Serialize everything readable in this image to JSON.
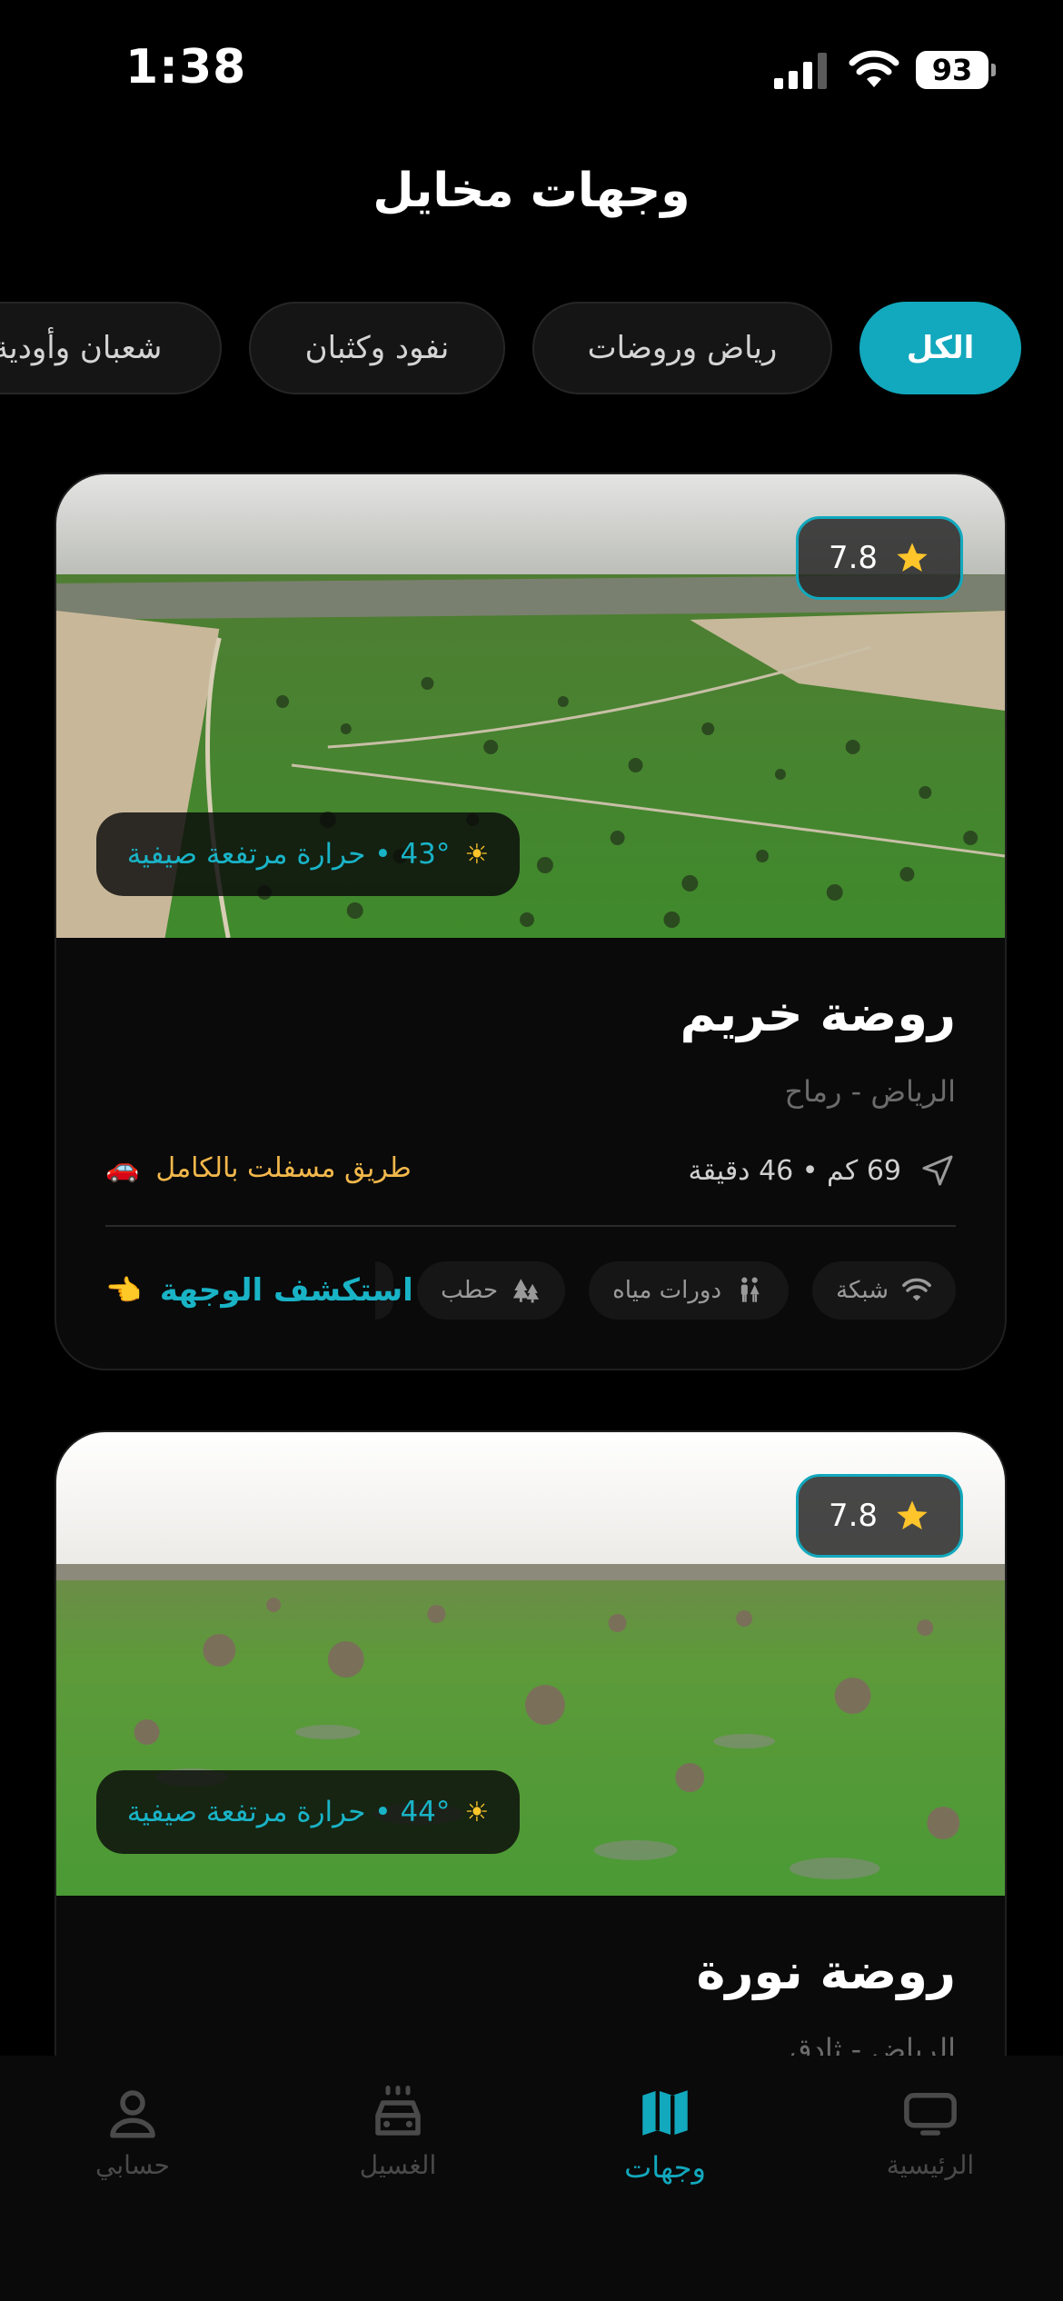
{
  "status_bar": {
    "time": "1:38",
    "battery": "93"
  },
  "title": "وجهات مخايل",
  "filters": [
    "الكل",
    "رياض وروضات",
    "نفود وكثبان",
    "شعبان وأودية"
  ],
  "cards": [
    {
      "rating": "7.8",
      "weather": "43° • حرارة مرتفعة صيفية",
      "name": "روضة خريم",
      "location": "الرياض - رماح",
      "distance": "69 كم • 46 دقيقة",
      "road": "طريق مسفلت بالكامل",
      "amenities": [
        "شبكة",
        "دورات مياه",
        "حطب"
      ],
      "explore": "استكشف الوجهة"
    },
    {
      "rating": "7.8",
      "weather": "44° • حرارة مرتفعة صيفية",
      "name": "روضة نورة",
      "location": "الرياض - ثادق"
    }
  ],
  "tabs": [
    {
      "label": "الرئيسية",
      "icon": "tv-icon"
    },
    {
      "label": "وجهات",
      "icon": "map-icon",
      "active": true
    },
    {
      "label": "الغسيل",
      "icon": "car-icon"
    },
    {
      "label": "حسابي",
      "icon": "person-icon"
    }
  ],
  "colors": {
    "accent": "#12a8bd",
    "star": "#ffc52b",
    "road": "#f2b84b",
    "background": "#000000"
  }
}
